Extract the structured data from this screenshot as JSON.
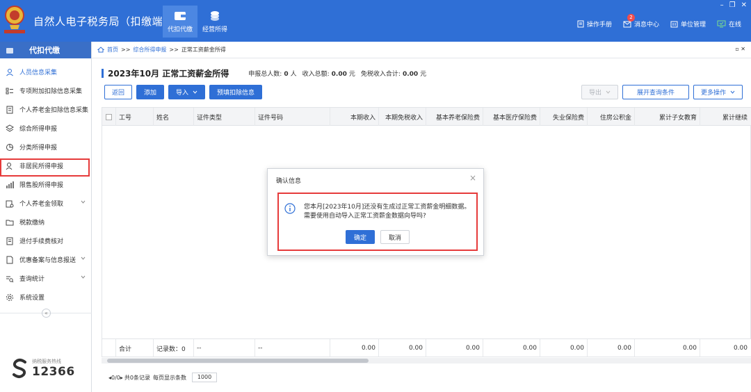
{
  "app": {
    "title": "自然人电子税务局（扣缴端）",
    "logo_text": "中国税务",
    "top_nav": [
      {
        "label": "代扣代缴",
        "icon": "wallet-icon",
        "active": true
      },
      {
        "label": "经营所得",
        "icon": "coins-icon",
        "active": false
      }
    ],
    "toolbar": {
      "manual": "操作手册",
      "messages": "消息中心",
      "message_count": "2",
      "unit_mgmt": "单位管理",
      "online": "在线"
    },
    "window_controls": {
      "minimize": "–",
      "restore": "❐",
      "close": "✕"
    }
  },
  "sidebar": {
    "header": "代扣代缴",
    "items": [
      {
        "label": "人员信息采集",
        "icon": "person-icon",
        "selected": true
      },
      {
        "label": "专项附加扣除信息采集",
        "icon": "list-icon"
      },
      {
        "label": "个人养老金扣除信息采集",
        "icon": "receipt-icon"
      },
      {
        "label": "综合所得申报",
        "icon": "layers-icon"
      },
      {
        "label": "分类所得申报",
        "icon": "pie-icon"
      },
      {
        "label": "非居民所得申报",
        "icon": "user-icon"
      },
      {
        "label": "限售股所得申报",
        "icon": "bars-icon"
      },
      {
        "label": "个人养老金领取",
        "icon": "pension-icon",
        "caret": true
      },
      {
        "label": "税款缴纳",
        "icon": "folder-icon"
      },
      {
        "label": "退付手续费核对",
        "icon": "doc-icon"
      },
      {
        "label": "优惠备案与信息报送",
        "icon": "file-icon",
        "caret": true
      },
      {
        "label": "查询统计",
        "icon": "search-list-icon",
        "caret": true
      },
      {
        "label": "系统设置",
        "icon": "gear-icon"
      }
    ],
    "collapse": "«",
    "hotline_label": "纳税服务热线",
    "hotline_number": "12366"
  },
  "breadcrumb": {
    "home": "首页",
    "sep": ">>",
    "level1": "综合所得申报",
    "current": "正常工资薪金所得",
    "controls": "▫ ✕"
  },
  "page": {
    "title": "2023年10月 正常工资薪金所得",
    "stats": {
      "people_label": "申报总人数:",
      "people_value": "0",
      "people_unit": "人",
      "income_label": "收入总额:",
      "income_value": "0.00",
      "income_unit": "元",
      "exempt_label": "免税收入合计:",
      "exempt_value": "0.00",
      "exempt_unit": "元"
    },
    "buttons": {
      "back": "返回",
      "add": "添加",
      "import": "导入",
      "prefill": "预填扣除信息",
      "export": "导出",
      "expand_query": "展开查询条件",
      "more": "更多操作"
    }
  },
  "table": {
    "columns": [
      "工号",
      "姓名",
      "证件类型",
      "证件号码",
      "本期收入",
      "本期免税收入",
      "基本养老保险费",
      "基本医疗保险费",
      "失业保险费",
      "住房公积金",
      "累计子女教育",
      "累计继续"
    ],
    "footer": {
      "total_label": "合计",
      "record_label": "记录数：0",
      "dash1": "--",
      "dash2": "--",
      "values": [
        "0.00",
        "0.00",
        "0.00",
        "0.00",
        "0.00",
        "0.00",
        "0.00",
        "0.00"
      ]
    }
  },
  "pager": {
    "pages": "0/0",
    "records": "共0条记录",
    "per_page_label": "每页显示条数",
    "per_page_value": "1000"
  },
  "dialog": {
    "title": "确认信息",
    "close": "×",
    "message_line1": "您本月[2023年10月]还没有生成过正常工资薪金明细数据。",
    "message_line2": "需要使用自动导入正常工资薪金数据向导吗?",
    "ok": "确定",
    "cancel": "取消"
  },
  "colors": {
    "brand_blue": "#2f6fd6",
    "highlight_red": "#e63a3a"
  }
}
